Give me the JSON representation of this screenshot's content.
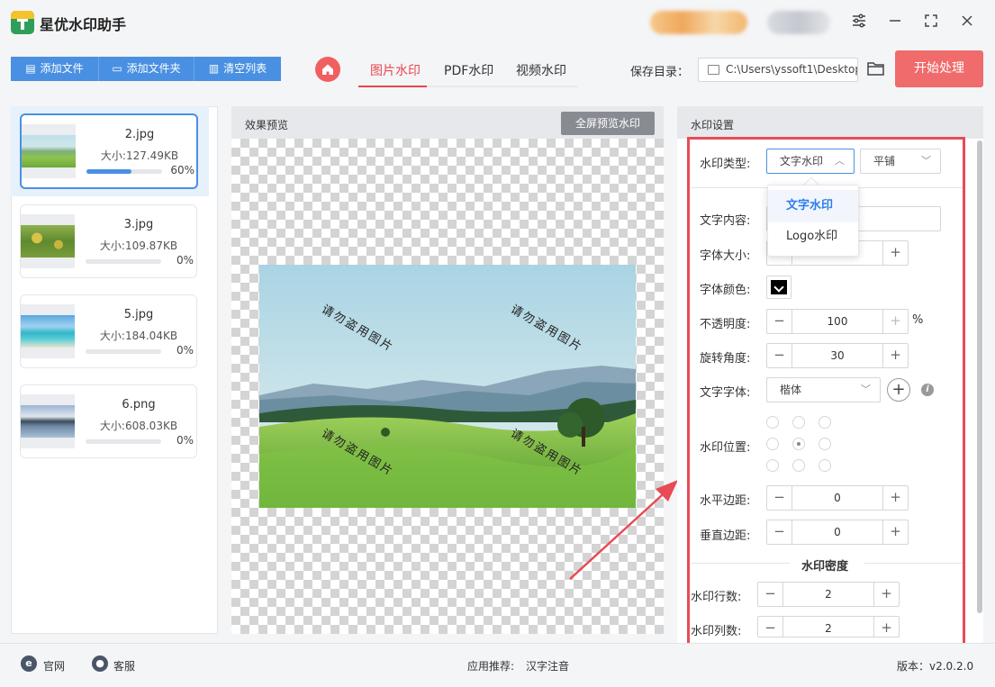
{
  "app": {
    "title": "星优水印助手"
  },
  "window_controls": {
    "settings_icon": "sliders-icon",
    "min": "minimize-icon",
    "max": "maximize-icon",
    "close": "close-icon"
  },
  "toolbar": {
    "add_file": "添加文件",
    "add_folder": "添加文件夹",
    "clear_list": "清空列表",
    "tabs": [
      "图片水印",
      "PDF水印",
      "视频水印"
    ],
    "active_tab": "图片水印",
    "save_dir_label": "保存目录：",
    "save_dir_value": "C:\\Users\\yssoft1\\Desktop",
    "start_button": "开始处理"
  },
  "files": [
    {
      "name": "2.jpg",
      "size": "大小:127.49KB",
      "progress": 60,
      "progress_text": "60%",
      "selected": true
    },
    {
      "name": "3.jpg",
      "size": "大小:109.87KB",
      "progress": 0,
      "progress_text": "0%",
      "selected": false
    },
    {
      "name": "5.jpg",
      "size": "大小:184.04KB",
      "progress": 0,
      "progress_text": "0%",
      "selected": false
    },
    {
      "name": "6.png",
      "size": "大小:608.03KB",
      "progress": 0,
      "progress_text": "0%",
      "selected": false
    }
  ],
  "preview": {
    "title": "效果预览",
    "fullscreen_button": "全屏预览水印",
    "watermark_text": "请勿盗用图片"
  },
  "settings": {
    "title": "水印设置",
    "type_label": "水印类型:",
    "type_value": "文字水印",
    "layout_value": "平铺",
    "type_options": [
      "文字水印",
      "Logo水印"
    ],
    "text_label": "文字内容:",
    "font_size_label": "字体大小:",
    "font_color_label": "字体颜色:",
    "font_color": "#000000",
    "opacity_label": "不透明度:",
    "opacity_value": "100",
    "opacity_unit": "%",
    "rotation_label": "旋转角度:",
    "rotation_value": "30",
    "font_label": "文字字体:",
    "font_value": "楷体",
    "position_label": "水印位置:",
    "h_margin_label": "水平边距:",
    "h_margin_value": "0",
    "v_margin_label": "垂直边距:",
    "v_margin_value": "0",
    "density_title": "水印密度",
    "rows_label": "水印行数:",
    "rows_value": "2",
    "cols_label": "水印列数:",
    "cols_value": "2"
  },
  "bottom": {
    "website": "官网",
    "support": "客服",
    "recommend_label": "应用推荐:",
    "recommend_app": "汉字注音",
    "version": "版本：v2.0.2.0"
  },
  "colors": {
    "accent_blue": "#4a90e2",
    "accent_red": "#e8474b",
    "start_button": "#f06b6b"
  }
}
